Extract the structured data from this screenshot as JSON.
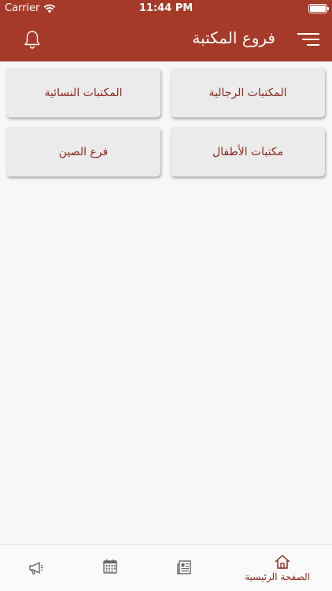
{
  "status_bar": {
    "carrier": "Carrier",
    "time": "11:44 PM"
  },
  "header": {
    "title": "فروع المكتبة",
    "menu_icon": "menu-icon",
    "bell_icon": "bell-icon"
  },
  "branches": [
    {
      "label": "المكتبات الرجالية"
    },
    {
      "label": "المكتبات النسائية"
    },
    {
      "label": "مكتبات الأطفال"
    },
    {
      "label": "فرع الصين"
    }
  ],
  "tab_bar": {
    "home_label": "الصفحة الرئيسية",
    "icons": [
      "home-icon",
      "newspaper-icon",
      "calendar-icon",
      "megaphone-icon"
    ]
  },
  "colors": {
    "primary": "#a63a28",
    "text_accent": "#8b2a1d",
    "card_bg": "#ebebeb"
  }
}
